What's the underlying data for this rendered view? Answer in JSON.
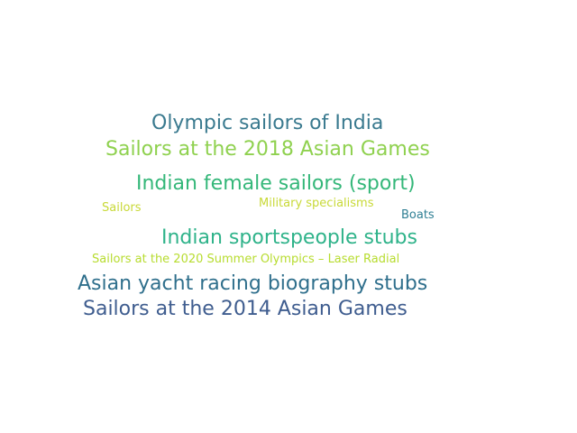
{
  "word_cloud": {
    "words": [
      {
        "text": "Olympic sailors of India",
        "color": "#3a7a8f"
      },
      {
        "text": "Sailors at the 2018 Asian Games",
        "color": "#8fd14f"
      },
      {
        "text": "Indian female sailors (sport)",
        "color": "#34b779"
      },
      {
        "text": "Sailors",
        "color": "#c8d937"
      },
      {
        "text": "Military specialisms",
        "color": "#c8d937"
      },
      {
        "text": "Boats",
        "color": "#2f7f94"
      },
      {
        "text": "Indian sportspeople stubs",
        "color": "#2fb38a"
      },
      {
        "text": "Sailors at the 2020 Summer Olympics – Laser Radial",
        "color": "#b7dc2f"
      },
      {
        "text": "Asian yacht racing biography stubs",
        "color": "#2f6f8c"
      },
      {
        "text": "Sailors at the 2014 Asian Games",
        "color": "#3f5d8f"
      }
    ]
  }
}
